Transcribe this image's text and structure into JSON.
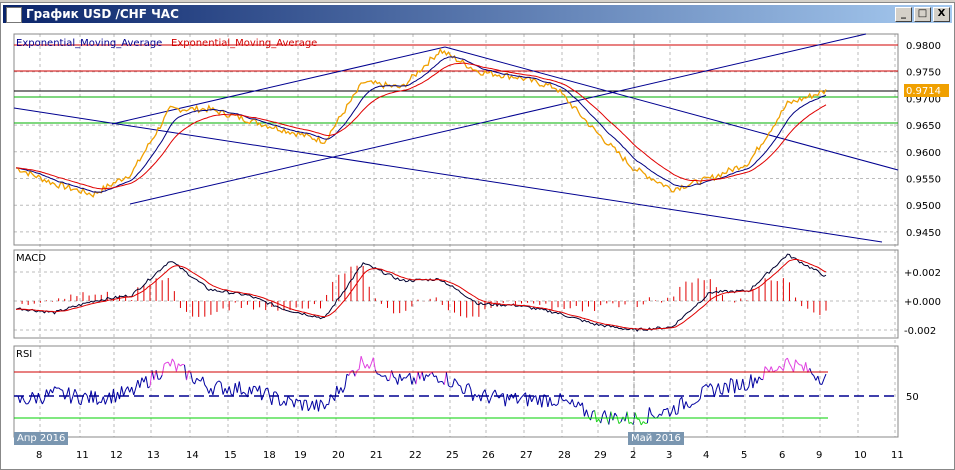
{
  "window": {
    "title": "График USD /CHF  ЧАС",
    "minimize": "_",
    "maximize": "□",
    "close": "X"
  },
  "main": {
    "legend1": "Exponential_Moving_Average",
    "legend2": "Exponential_Moving_Average",
    "current_price": "0.9714",
    "yticks": [
      "0.9800",
      "0.9750",
      "0.9700",
      "0.9650",
      "0.9600",
      "0.9550",
      "0.9500",
      "0.9450"
    ]
  },
  "macd": {
    "label": "MACD",
    "yticks": [
      "+0.002",
      "+0.000",
      "-0.002"
    ]
  },
  "rsi": {
    "label": "RSI",
    "ytick": "50"
  },
  "xaxis": {
    "labels": [
      "8",
      "11",
      "12",
      "13",
      "14",
      "15",
      "18",
      "19",
      "20",
      "21",
      "22",
      "25",
      "26",
      "27",
      "28",
      "29",
      "2",
      "3",
      "4",
      "5",
      "6",
      "9",
      "10",
      "11"
    ],
    "month1": "Апр 2016",
    "month2": "Май 2016"
  },
  "colors": {
    "price": "#f0a000",
    "ema_fast": "#000080",
    "ema_slow": "#e00000",
    "accent": "#f0a000"
  },
  "chart_data": {
    "type": "line",
    "price": [
      0.957,
      0.954,
      0.952,
      0.956,
      0.968,
      0.968,
      0.966,
      0.964,
      0.962,
      0.973,
      0.972,
      0.979,
      0.975,
      0.974,
      0.972,
      0.964,
      0.957,
      0.953,
      0.955,
      0.958,
      0.969,
      0.9714
    ],
    "macd": [
      -0.0005,
      -0.0008,
      0.0,
      0.0004,
      0.0028,
      0.0008,
      0.0004,
      -0.0006,
      -0.0012,
      0.0026,
      0.0014,
      0.0015,
      -0.0002,
      -0.0003,
      -0.0008,
      -0.0016,
      -0.002,
      -0.0018,
      0.0006,
      0.0007,
      0.0032,
      0.0017
    ],
    "rsi": [
      45,
      52,
      48,
      53,
      78,
      58,
      56,
      45,
      40,
      82,
      62,
      68,
      50,
      47,
      47,
      33,
      30,
      38,
      55,
      62,
      80,
      65
    ]
  }
}
